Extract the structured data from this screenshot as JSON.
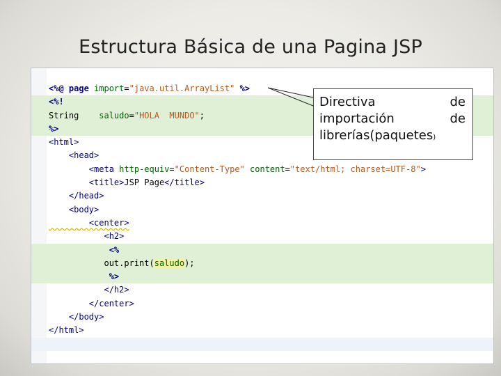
{
  "slide": {
    "title": "Estructura Básica de una Pagina JSP"
  },
  "code_lines": [
    {
      "tokens": [
        {
          "c": "t-dir",
          "t": "<%@ page "
        },
        {
          "c": "t-attr",
          "t": "import"
        },
        {
          "c": "t-plain",
          "t": "="
        },
        {
          "c": "t-val",
          "t": "\"java.util.ArrayList\""
        },
        {
          "c": "t-dir",
          "t": " %>"
        }
      ]
    },
    {
      "hl": true,
      "tokens": [
        {
          "c": "t-dir",
          "t": "<%!"
        }
      ]
    },
    {
      "hl": true,
      "tokens": [
        {
          "c": "t-plain",
          "t": "String    "
        },
        {
          "c": "t-var",
          "t": "saludo"
        },
        {
          "c": "t-plain",
          "t": "="
        },
        {
          "c": "t-val",
          "t": "\"HOLA  MUNDO\""
        },
        {
          "c": "t-plain",
          "t": ";"
        }
      ]
    },
    {
      "hl": true,
      "tokens": [
        {
          "c": "t-dir",
          "t": "%>"
        }
      ]
    },
    {
      "tokens": [
        {
          "c": "t-tag",
          "t": "<html>"
        }
      ]
    },
    {
      "tokens": [
        {
          "c": "t-tag",
          "t": "    <head>"
        }
      ]
    },
    {
      "tokens": [
        {
          "c": "t-tag",
          "t": "        <meta "
        },
        {
          "c": "t-attr",
          "t": "http-equiv"
        },
        {
          "c": "t-plain",
          "t": "="
        },
        {
          "c": "t-val",
          "t": "\"Content-Type\""
        },
        {
          "c": "t-plain",
          "t": " "
        },
        {
          "c": "t-attr",
          "t": "content"
        },
        {
          "c": "t-plain",
          "t": "="
        },
        {
          "c": "t-val",
          "t": "\"text/html; charset=UTF-8\""
        },
        {
          "c": "t-tag",
          "t": ">"
        }
      ]
    },
    {
      "tokens": [
        {
          "c": "t-tag",
          "t": "        <title>"
        },
        {
          "c": "t-plain",
          "t": "JSP Page"
        },
        {
          "c": "t-tag",
          "t": "</title>"
        }
      ]
    },
    {
      "tokens": [
        {
          "c": "t-tag",
          "t": "    </head>"
        }
      ]
    },
    {
      "tokens": [
        {
          "c": "t-tag",
          "t": "    <body>"
        }
      ]
    },
    {
      "tokens": [
        {
          "c": "t-tag wavy",
          "t": "        <center>"
        }
      ]
    },
    {
      "tokens": [
        {
          "c": "t-tag",
          "t": "           <h2>"
        }
      ]
    },
    {
      "hl": true,
      "tokens": [
        {
          "c": "t-dir",
          "t": "            <%"
        }
      ]
    },
    {
      "hl": true,
      "tokens": [
        {
          "c": "t-plain",
          "t": "           out.print("
        },
        {
          "c": "t-hlvar",
          "t": "saludo"
        },
        {
          "c": "t-plain",
          "t": ");"
        }
      ]
    },
    {
      "hl": true,
      "tokens": [
        {
          "c": "t-dir",
          "t": "            %>"
        }
      ]
    },
    {
      "tokens": [
        {
          "c": "t-tag",
          "t": "           </h2>"
        }
      ]
    },
    {
      "tokens": [
        {
          "c": "t-tag",
          "t": "        </center>"
        }
      ]
    },
    {
      "tokens": [
        {
          "c": "t-tag",
          "t": "    </body>"
        }
      ]
    },
    {
      "tokens": [
        {
          "c": "t-tag",
          "t": "</html>"
        }
      ]
    },
    {
      "tail": true,
      "tokens": []
    }
  ],
  "callout": {
    "line1_a": "Directiva",
    "line1_b": "de",
    "line2_a": "importación",
    "line2_b": "de",
    "line3": "librerías(paquetes",
    "line3_close": ")"
  }
}
